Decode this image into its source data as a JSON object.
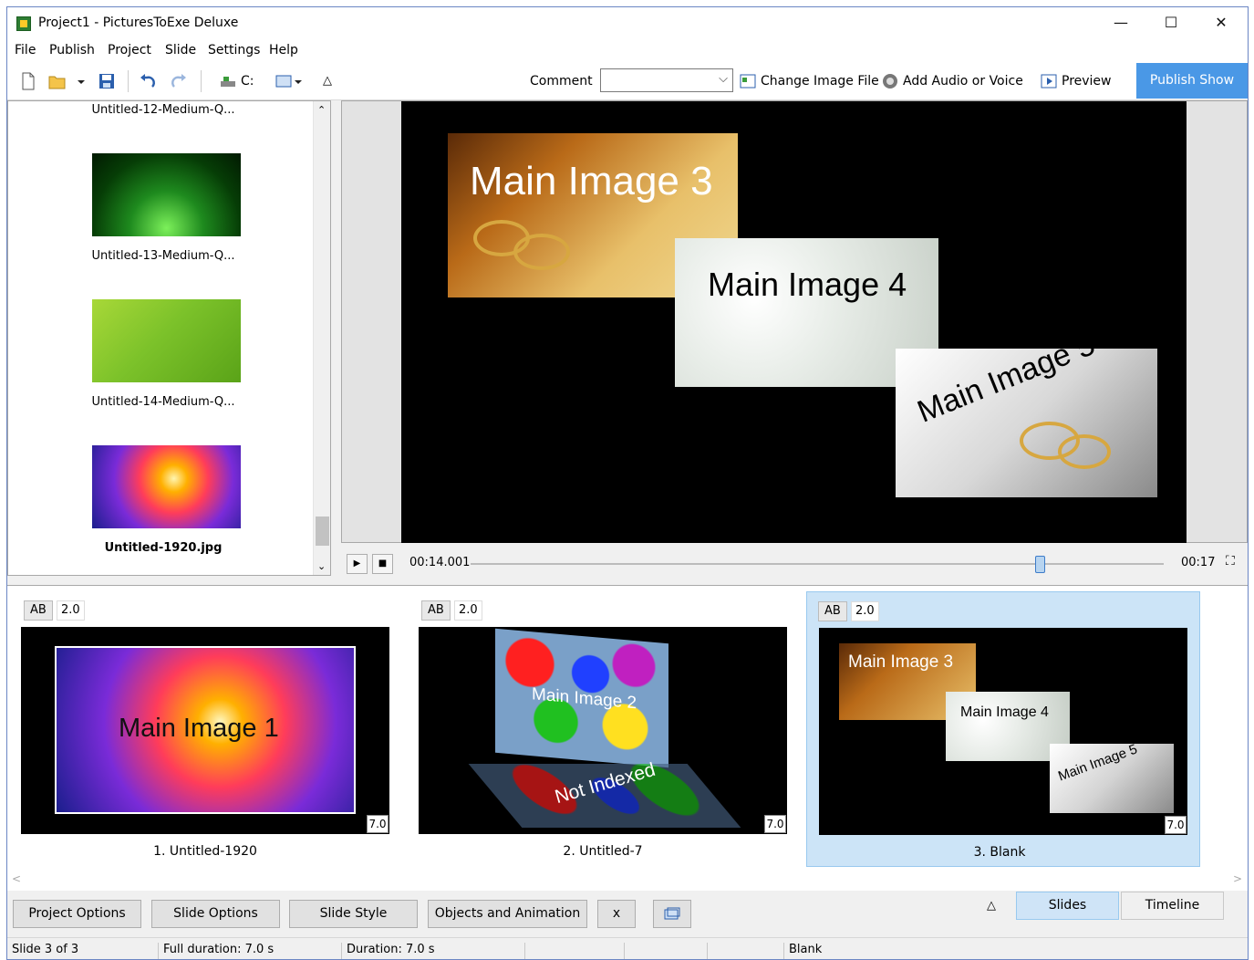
{
  "window": {
    "title": "Project1 - PicturesToExe Deluxe",
    "controls": [
      "—",
      "☐",
      "✕"
    ]
  },
  "menu": [
    "File",
    "Publish",
    "Project",
    "Slide",
    "Settings",
    "Help"
  ],
  "toolbar": {
    "drive": "C:",
    "comment_label": "Comment",
    "comment_value": "",
    "change_image": "Change Image File",
    "add_audio": "Add Audio or Voice",
    "preview": "Preview",
    "publish": "Publish Show"
  },
  "files": [
    {
      "name": "Untitled-12-Medium-Q...",
      "bold": false
    },
    {
      "name": "Untitled-13-Medium-Q...",
      "bold": false
    },
    {
      "name": "Untitled-14-Medium-Q...",
      "bold": false
    },
    {
      "name": "Untitled-1920.jpg",
      "bold": true
    }
  ],
  "preview": {
    "images": [
      "Main Image 3",
      "Main Image 4",
      "Main Image 5"
    ],
    "time_current": "00:14.001",
    "time_total": "00:17",
    "position": 0.824
  },
  "slides": [
    {
      "ab": "AB",
      "transition": "2.0",
      "duration": "7.0",
      "caption": "1. Untitled-1920",
      "text": "Main Image 1",
      "selected": false
    },
    {
      "ab": "AB",
      "transition": "2.0",
      "duration": "7.0",
      "caption": "2. Untitled-7",
      "text": "Main Image 2",
      "reflection": "Not Indexed",
      "selected": false
    },
    {
      "ab": "AB",
      "transition": "2.0",
      "duration": "7.0",
      "caption": "3. Blank",
      "texts": [
        "Main Image 3",
        "Main Image 4",
        "Main Image 5"
      ],
      "selected": true
    }
  ],
  "bottom_buttons": [
    "Project Options",
    "Slide Options",
    "Slide Style",
    "Objects and Animation",
    "x"
  ],
  "tabs": [
    "Slides",
    "Timeline"
  ],
  "status": [
    "Slide 3 of 3",
    "Full duration: 7.0 s",
    "Duration: 7.0 s",
    "",
    "",
    "",
    "Blank"
  ]
}
